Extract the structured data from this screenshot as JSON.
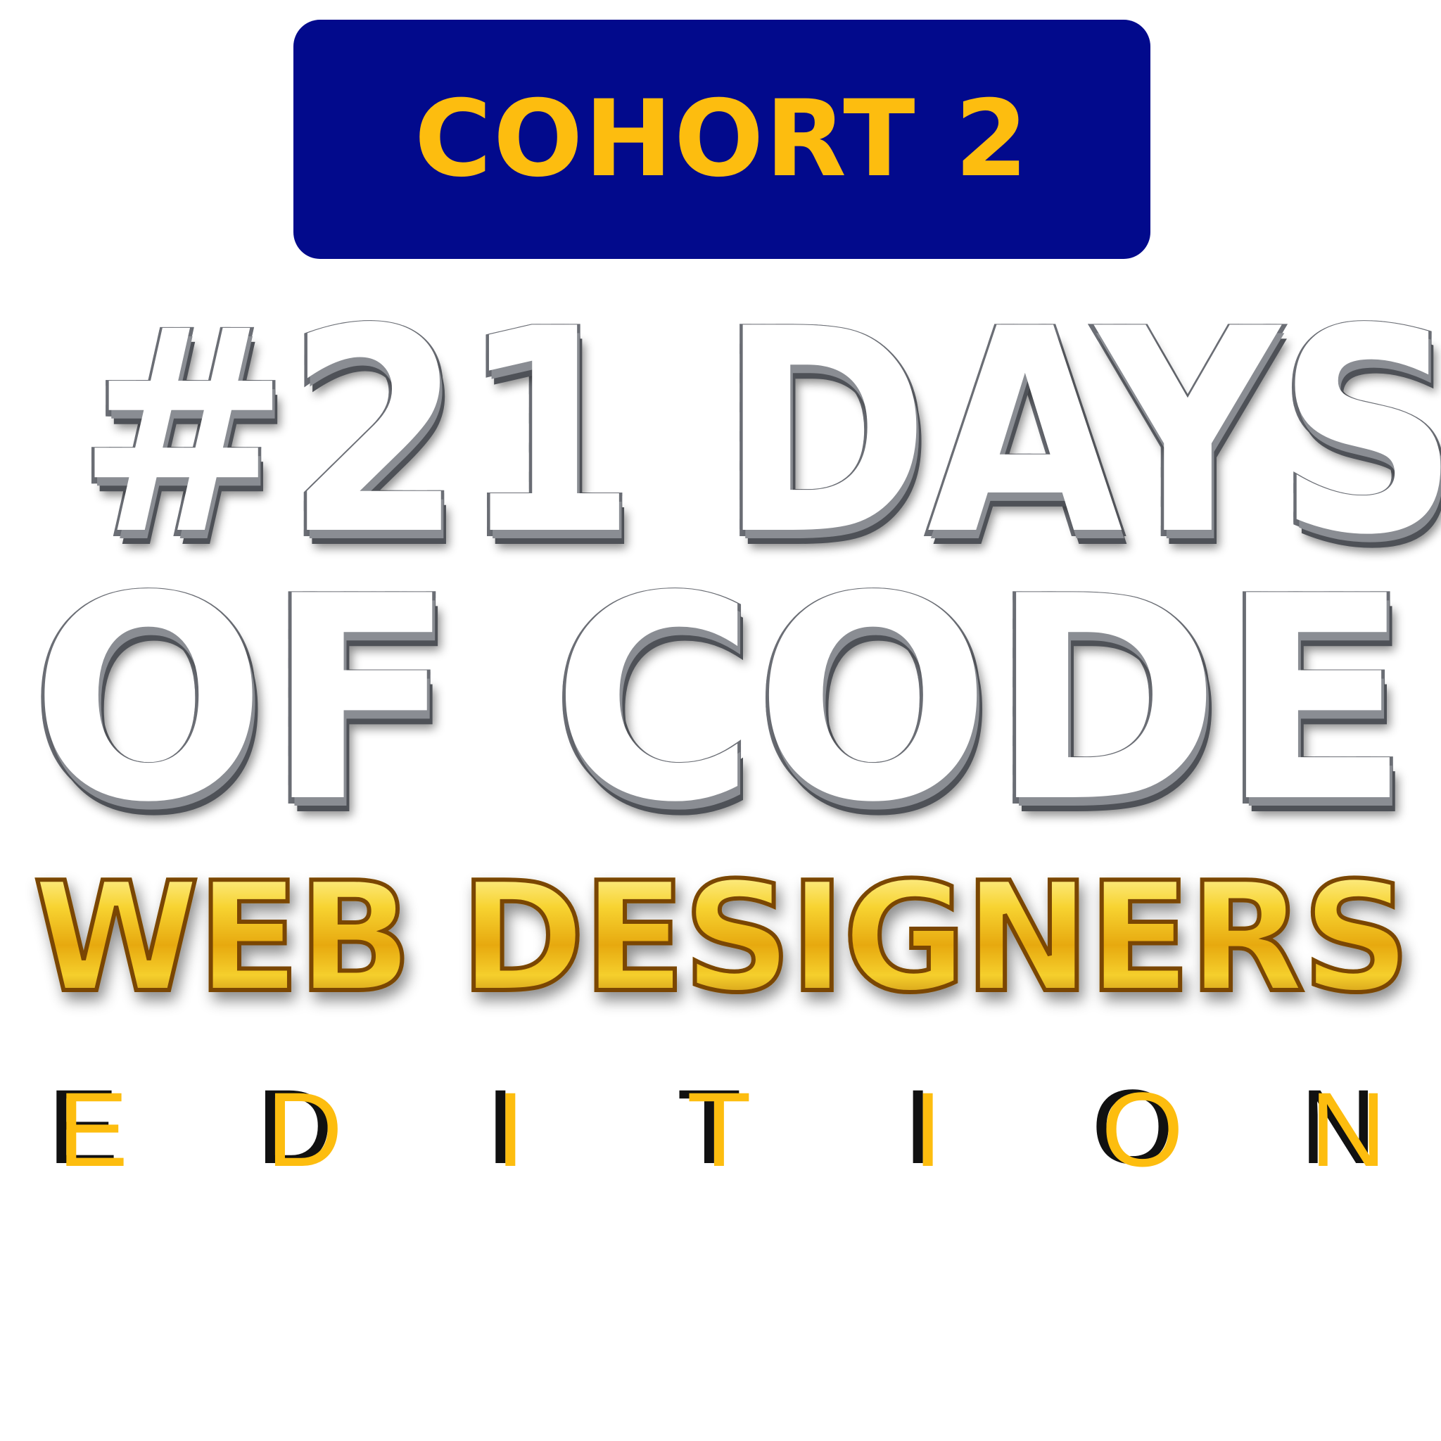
{
  "badge": {
    "label": "COHORT 2",
    "background_color": "#020a8c",
    "text_color": "#fdbd0f"
  },
  "headline": {
    "line1": "#21 DAYS",
    "line2": "OF CODE",
    "style": "diamond"
  },
  "subtitle": {
    "text": "WEB DESIGNERS",
    "style": "gold"
  },
  "edition": {
    "letters": [
      "E",
      "D",
      "I",
      "T",
      "I",
      "O",
      "N"
    ],
    "fill_color": "#fdbd0f",
    "shadow_color": "#111111"
  }
}
